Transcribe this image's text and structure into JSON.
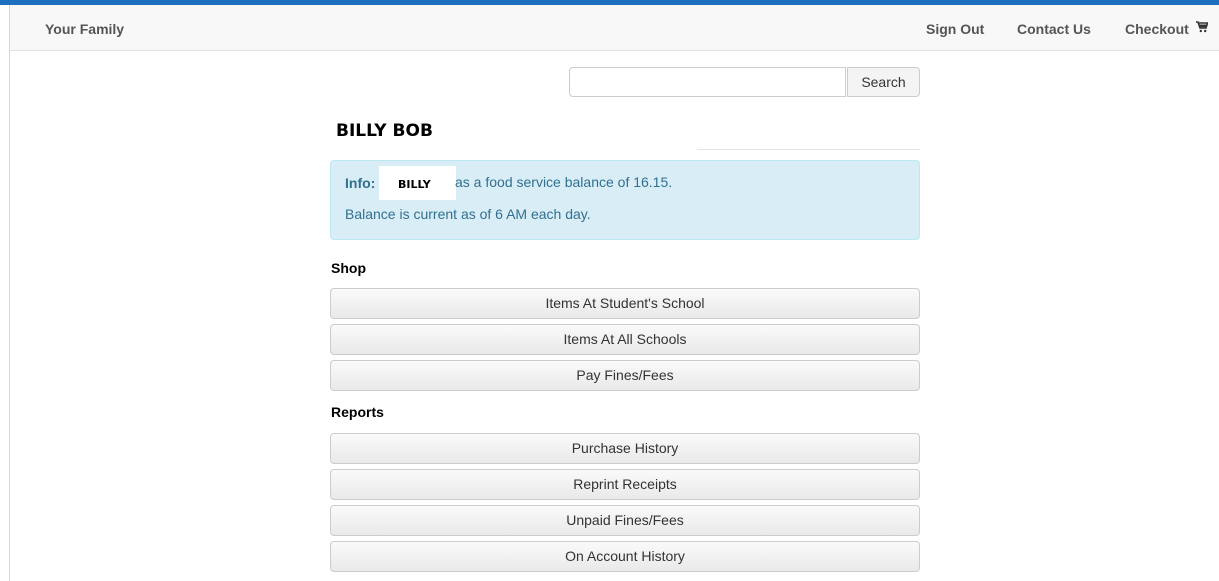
{
  "navbar": {
    "brand": "Your Family",
    "sign_out": "Sign Out",
    "contact_us": "Contact Us",
    "checkout": "Checkout",
    "cart_icon": "shopping-cart-icon"
  },
  "search": {
    "value": "",
    "placeholder": "",
    "button_label": "Search"
  },
  "student": {
    "name": "BILLY BOB"
  },
  "info": {
    "label": "Info:",
    "redacted_name": "BILLY",
    "balance_text": "as a food service balance of 16.15.",
    "balance_note": "Balance is current as of 6 AM each day."
  },
  "shop": {
    "heading": "Shop",
    "buttons": [
      "Items At Student's School",
      "Items At All Schools",
      "Pay Fines/Fees"
    ]
  },
  "reports": {
    "heading": "Reports",
    "buttons": [
      "Purchase History",
      "Reprint Receipts",
      "Unpaid Fines/Fees",
      "On Account History"
    ]
  },
  "colors": {
    "top_accent": "#1f6fbf",
    "info_bg": "#d9edf7",
    "info_text": "#31708f"
  }
}
